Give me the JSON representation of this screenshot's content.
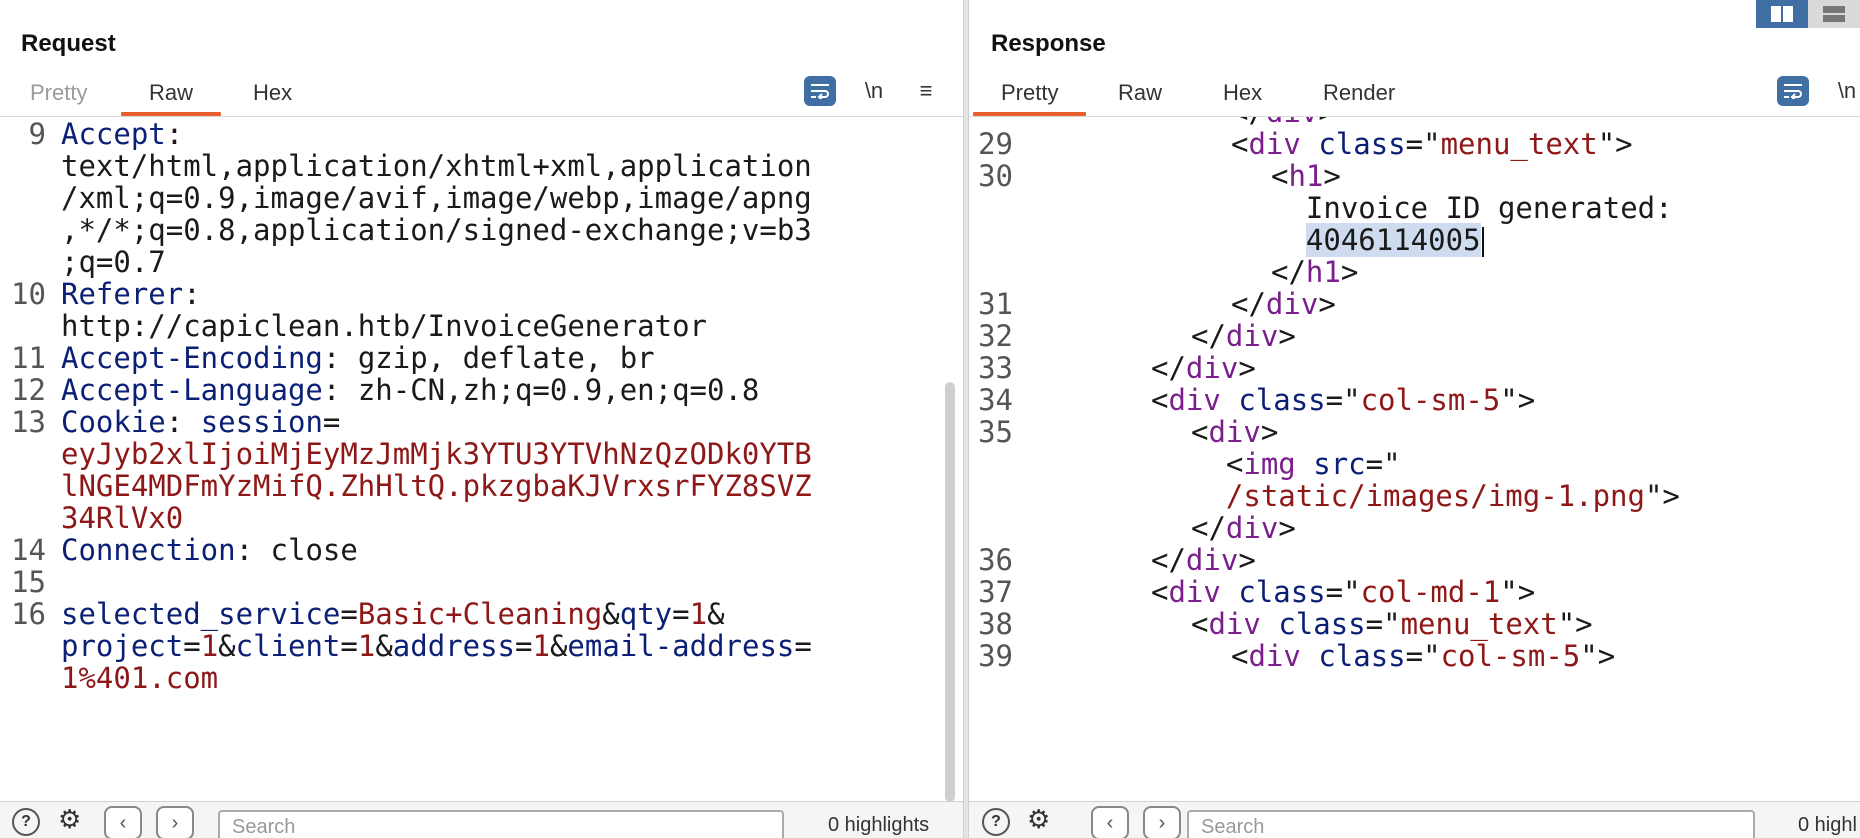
{
  "request": {
    "title": "Request",
    "tabs": [
      {
        "label": "Pretty",
        "state": "disabled"
      },
      {
        "label": "Raw",
        "state": "active"
      },
      {
        "label": "Hex",
        "state": "normal"
      }
    ],
    "toolbar": {
      "newline_label": "\\n",
      "menu_label": "≡"
    },
    "lines": [
      {
        "num": "9",
        "rows": [
          [
            {
              "c": "k",
              "t": "Accept"
            },
            {
              "c": "v",
              "t": ":"
            }
          ],
          [
            {
              "c": "v",
              "t": "text/html,application/xhtml+xml,application"
            }
          ],
          [
            {
              "c": "v",
              "t": "/xml;q=0.9,image/avif,image/webp,image/apng"
            }
          ],
          [
            {
              "c": "v",
              "t": ",*/*;q=0.8,application/signed-exchange;v=b3"
            }
          ],
          [
            {
              "c": "v",
              "t": ";q=0.7"
            }
          ]
        ]
      },
      {
        "num": "10",
        "rows": [
          [
            {
              "c": "k",
              "t": "Referer"
            },
            {
              "c": "v",
              "t": ":"
            }
          ],
          [
            {
              "c": "v",
              "t": "http://capiclean.htb/InvoiceGenerator"
            }
          ]
        ]
      },
      {
        "num": "11",
        "rows": [
          [
            {
              "c": "k",
              "t": "Accept-Encoding"
            },
            {
              "c": "v",
              "t": ": gzip, deflate, br"
            }
          ]
        ]
      },
      {
        "num": "12",
        "rows": [
          [
            {
              "c": "k",
              "t": "Accept-Language"
            },
            {
              "c": "v",
              "t": ": zh-CN,zh;q=0.9,en;q=0.8"
            }
          ]
        ]
      },
      {
        "num": "13",
        "rows": [
          [
            {
              "c": "k",
              "t": "Cookie"
            },
            {
              "c": "v",
              "t": ": "
            },
            {
              "c": "k",
              "t": "session"
            },
            {
              "c": "v",
              "t": "="
            }
          ],
          [
            {
              "c": "r",
              "t": "eyJyb2xlIjoiMjEyMzJmMjk3YTU3YTVhNzQzODk0YTB"
            }
          ],
          [
            {
              "c": "r",
              "t": "lNGE4MDFmYzMifQ.ZhHltQ.pkzgbaKJVrxsrFYZ8SVZ"
            }
          ],
          [
            {
              "c": "r",
              "t": "34RlVx0"
            }
          ]
        ]
      },
      {
        "num": "14",
        "rows": [
          [
            {
              "c": "k",
              "t": "Connection"
            },
            {
              "c": "v",
              "t": ": close"
            }
          ]
        ]
      },
      {
        "num": "15",
        "rows": [
          [
            {
              "c": "v",
              "t": ""
            }
          ]
        ]
      },
      {
        "num": "16",
        "rows": [
          [
            {
              "c": "k",
              "t": "selected_service"
            },
            {
              "c": "v",
              "t": "="
            },
            {
              "c": "r",
              "t": "Basic+Cleaning"
            },
            {
              "c": "v",
              "t": "&"
            },
            {
              "c": "k",
              "t": "qty"
            },
            {
              "c": "v",
              "t": "="
            },
            {
              "c": "r",
              "t": "1"
            },
            {
              "c": "v",
              "t": "&"
            }
          ],
          [
            {
              "c": "k",
              "t": "project"
            },
            {
              "c": "v",
              "t": "="
            },
            {
              "c": "r",
              "t": "1"
            },
            {
              "c": "v",
              "t": "&"
            },
            {
              "c": "k",
              "t": "client"
            },
            {
              "c": "v",
              "t": "="
            },
            {
              "c": "r",
              "t": "1"
            },
            {
              "c": "v",
              "t": "&"
            },
            {
              "c": "k",
              "t": "address"
            },
            {
              "c": "v",
              "t": "="
            },
            {
              "c": "r",
              "t": "1"
            },
            {
              "c": "v",
              "t": "&"
            },
            {
              "c": "k",
              "t": "email-address"
            },
            {
              "c": "v",
              "t": "="
            }
          ],
          [
            {
              "c": "r",
              "t": "1%401.com"
            }
          ]
        ]
      }
    ],
    "bottom": {
      "search_placeholder": "Search",
      "highlights": "0 highlights"
    }
  },
  "response": {
    "title": "Response",
    "tabs": [
      {
        "label": "Pretty",
        "state": "active"
      },
      {
        "label": "Raw",
        "state": "normal"
      },
      {
        "label": "Hex",
        "state": "normal"
      },
      {
        "label": "Render",
        "state": "normal"
      }
    ],
    "toolbar": {
      "newline_label": "\\n"
    },
    "lines": [
      {
        "num": "",
        "indent": 5,
        "rows": [
          [
            {
              "c": "v",
              "t": "</"
            },
            {
              "c": "t",
              "t": "div"
            },
            {
              "c": "v",
              "t": ">"
            }
          ]
        ]
      },
      {
        "num": "29",
        "indent": 5,
        "rows": [
          [
            {
              "c": "v",
              "t": "<"
            },
            {
              "c": "t",
              "t": "div"
            },
            {
              "c": "v",
              "t": " "
            },
            {
              "c": "k",
              "t": "class"
            },
            {
              "c": "v",
              "t": "=\""
            },
            {
              "c": "r",
              "t": "menu_text"
            },
            {
              "c": "v",
              "t": "\">"
            }
          ]
        ]
      },
      {
        "num": "30",
        "indent": 6,
        "rows": [
          [
            {
              "c": "v",
              "t": "<"
            },
            {
              "c": "t",
              "t": "h1"
            },
            {
              "c": "v",
              "t": ">"
            }
          ],
          [
            {
              "c": "v",
              "t": "  Invoice ID generated:"
            }
          ],
          [
            {
              "c": "v",
              "t": "  "
            },
            {
              "c": "sel",
              "t": "4046114005"
            },
            {
              "c": "caret",
              "t": ""
            }
          ],
          [
            {
              "c": "v",
              "t": "</"
            },
            {
              "c": "t",
              "t": "h1"
            },
            {
              "c": "v",
              "t": ">"
            }
          ]
        ]
      },
      {
        "num": "31",
        "indent": 5,
        "rows": [
          [
            {
              "c": "v",
              "t": "</"
            },
            {
              "c": "t",
              "t": "div"
            },
            {
              "c": "v",
              "t": ">"
            }
          ]
        ]
      },
      {
        "num": "32",
        "indent": 4,
        "rows": [
          [
            {
              "c": "v",
              "t": "</"
            },
            {
              "c": "t",
              "t": "div"
            },
            {
              "c": "v",
              "t": ">"
            }
          ]
        ]
      },
      {
        "num": "33",
        "indent": 3,
        "rows": [
          [
            {
              "c": "v",
              "t": "</"
            },
            {
              "c": "t",
              "t": "div"
            },
            {
              "c": "v",
              "t": ">"
            }
          ]
        ]
      },
      {
        "num": "34",
        "indent": 3,
        "rows": [
          [
            {
              "c": "v",
              "t": "<"
            },
            {
              "c": "t",
              "t": "div"
            },
            {
              "c": "v",
              "t": " "
            },
            {
              "c": "k",
              "t": "class"
            },
            {
              "c": "v",
              "t": "=\""
            },
            {
              "c": "r",
              "t": "col-sm-5"
            },
            {
              "c": "v",
              "t": "\">"
            }
          ]
        ]
      },
      {
        "num": "35",
        "indent": 4,
        "rows": [
          [
            {
              "c": "v",
              "t": "<"
            },
            {
              "c": "t",
              "t": "div"
            },
            {
              "c": "v",
              "t": ">"
            }
          ],
          [
            {
              "c": "v",
              "t": "  <"
            },
            {
              "c": "t",
              "t": "img"
            },
            {
              "c": "v",
              "t": " "
            },
            {
              "c": "k",
              "t": "src"
            },
            {
              "c": "v",
              "t": "=\""
            }
          ],
          [
            {
              "c": "v",
              "t": "  "
            },
            {
              "c": "r",
              "t": "/static/images/img-1.png"
            },
            {
              "c": "v",
              "t": "\">"
            }
          ],
          [
            {
              "c": "v",
              "t": "</"
            },
            {
              "c": "t",
              "t": "div"
            },
            {
              "c": "v",
              "t": ">"
            }
          ]
        ]
      },
      {
        "num": "36",
        "indent": 3,
        "rows": [
          [
            {
              "c": "v",
              "t": "</"
            },
            {
              "c": "t",
              "t": "div"
            },
            {
              "c": "v",
              "t": ">"
            }
          ]
        ]
      },
      {
        "num": "37",
        "indent": 3,
        "rows": [
          [
            {
              "c": "v",
              "t": "<"
            },
            {
              "c": "t",
              "t": "div"
            },
            {
              "c": "v",
              "t": " "
            },
            {
              "c": "k",
              "t": "class"
            },
            {
              "c": "v",
              "t": "=\""
            },
            {
              "c": "r",
              "t": "col-md-1"
            },
            {
              "c": "v",
              "t": "\">"
            }
          ]
        ]
      },
      {
        "num": "38",
        "indent": 4,
        "rows": [
          [
            {
              "c": "v",
              "t": "<"
            },
            {
              "c": "t",
              "t": "div"
            },
            {
              "c": "v",
              "t": " "
            },
            {
              "c": "k",
              "t": "class"
            },
            {
              "c": "v",
              "t": "=\""
            },
            {
              "c": "r",
              "t": "menu_text"
            },
            {
              "c": "v",
              "t": "\">"
            }
          ]
        ]
      },
      {
        "num": "39",
        "indent": 5,
        "rows": [
          [
            {
              "c": "v",
              "t": "<"
            },
            {
              "c": "t",
              "t": "div"
            },
            {
              "c": "v",
              "t": " "
            },
            {
              "c": "k",
              "t": "class"
            },
            {
              "c": "v",
              "t": "=\""
            },
            {
              "c": "r",
              "t": "col-sm-5"
            },
            {
              "c": "v",
              "t": "\">"
            }
          ]
        ]
      }
    ],
    "bottom": {
      "search_placeholder": "Search",
      "highlights": "0 highl"
    }
  },
  "colors": {
    "accent": "#e8602c",
    "button_blue": "#3f6fa3",
    "key": "#0a1f75",
    "value_red": "#8e1717",
    "tag": "#7a1f8c"
  }
}
